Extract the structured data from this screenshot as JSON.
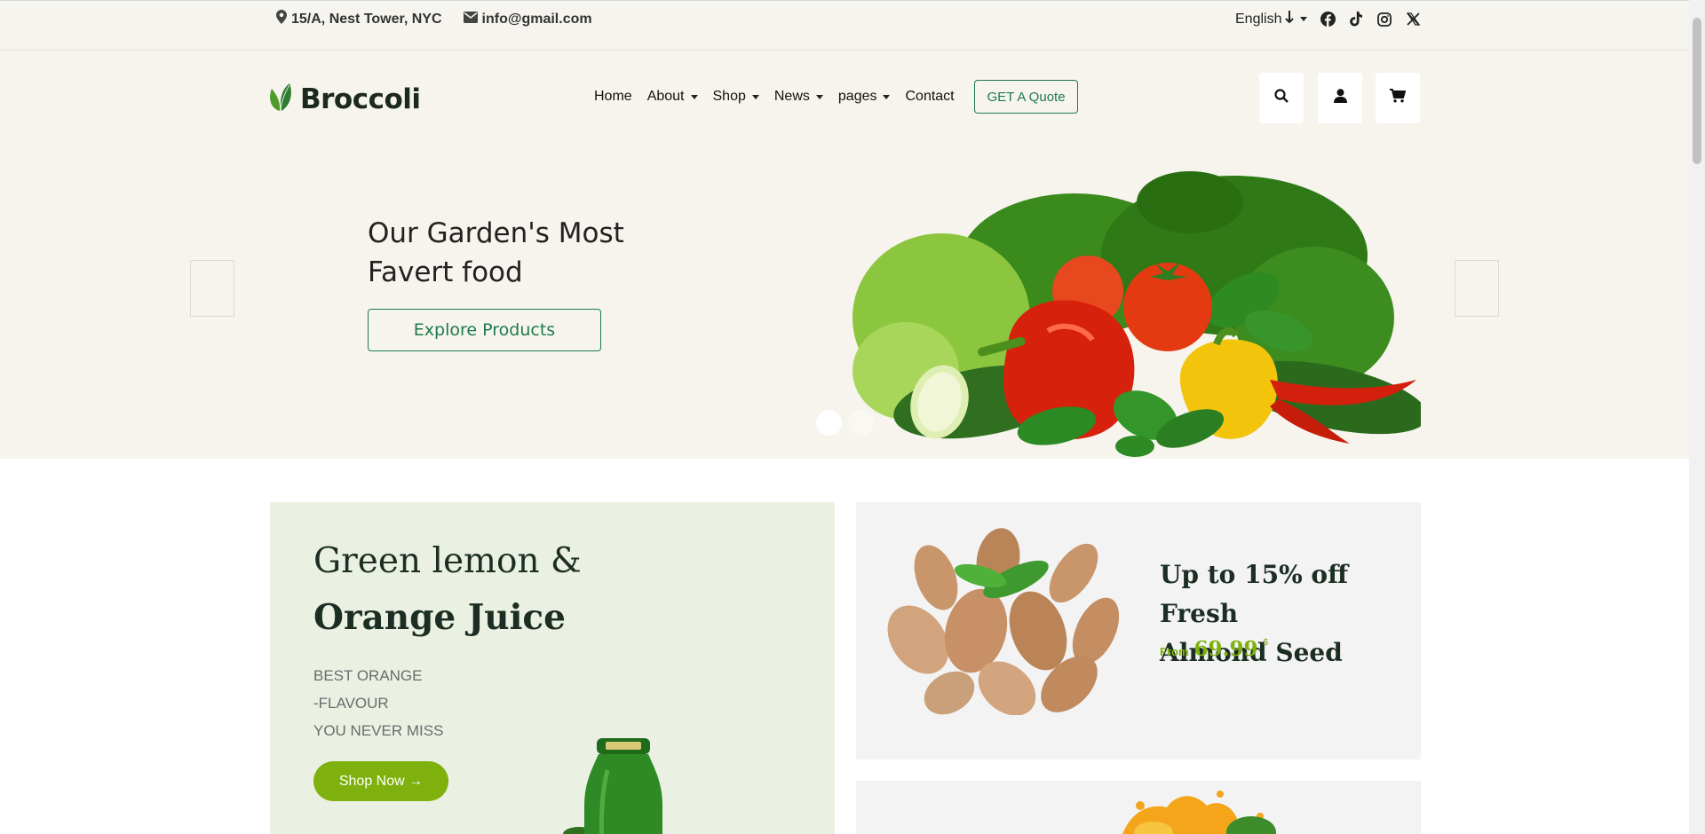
{
  "topbar": {
    "address": "15/A, Nest Tower, NYC",
    "email": "info@gmail.com",
    "language": "English",
    "social_icons": [
      "facebook-icon",
      "tiktok-icon",
      "instagram-icon",
      "x-icon"
    ]
  },
  "brand": {
    "name": "Broccoli",
    "accent_color": "#1d7a4e",
    "lime_color": "#7eb10d"
  },
  "nav": {
    "items": [
      {
        "label": "Home",
        "dropdown": false
      },
      {
        "label": "About",
        "dropdown": true
      },
      {
        "label": "Shop",
        "dropdown": true
      },
      {
        "label": "News",
        "dropdown": true
      },
      {
        "label": "pages",
        "dropdown": true
      },
      {
        "label": "Contact",
        "dropdown": false
      }
    ],
    "quote_label": "GET A Quote",
    "icons": [
      "search-icon",
      "user-icon",
      "cart-icon"
    ]
  },
  "hero": {
    "title_line1": "Our Garden's Most",
    "title_line2": "Favert food",
    "button_label": "Explore Products",
    "slide_count": 2,
    "active_slide": 1
  },
  "promo_juice": {
    "line1": "Green lemon &",
    "line2": "Orange Juice",
    "sub1": "BEST ORANGE",
    "sub2": "-FLAVOUR",
    "sub3": "YOU NEVER MISS",
    "button_label": "Shop Now →"
  },
  "promo_almond": {
    "title_line1": "Up to 15% off Fresh",
    "title_line2": "Almond Seed",
    "from_label": "From",
    "price": "69.99",
    "currency": "$"
  }
}
